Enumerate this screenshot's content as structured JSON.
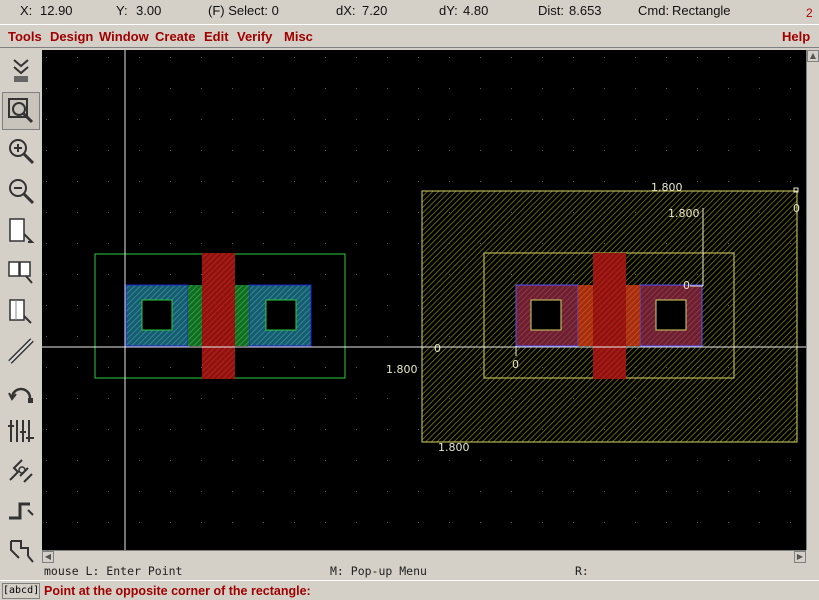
{
  "status": {
    "x_label": "X:",
    "x_value": "12.90",
    "y_label": "Y:",
    "y_value": "3.00",
    "select": "(F) Select: 0",
    "dx_label": "dX:",
    "dx_value": "7.20",
    "dy_label": "dY:",
    "dy_value": "4.80",
    "dist_label": "Dist:",
    "dist_value": "8.653",
    "cmd_label": "Cmd:",
    "cmd_value": "Rectangle",
    "window_number": "2"
  },
  "menu": {
    "items": [
      "Tools",
      "Design",
      "Window",
      "Create",
      "Edit",
      "Verify",
      "Misc"
    ],
    "help": "Help"
  },
  "toolbar": {
    "tools": [
      "save-icon",
      "zoom-fit-icon",
      "zoom-in-icon",
      "zoom-out-icon",
      "select-box-icon",
      "copy-icon",
      "stretch-icon",
      "ruler-icon",
      "undo-icon",
      "align-icon",
      "route-icon",
      "path-icon",
      "polygon-icon"
    ]
  },
  "canvas": {
    "dimension_labels": {
      "top_width": "1.800",
      "top_inner": "1.800",
      "left_mid": "1.800",
      "bottom": "1.800",
      "zero_top_right": "0",
      "zero_inner": "0",
      "zero_center": "0",
      "zero_bottom": "0"
    },
    "colors": {
      "background": "#000000",
      "grid_dot": "#5a5a5a",
      "crosshair": "#ffffff",
      "selection_box": "#d4d465",
      "hatch_fill": "#6a6a10",
      "cell_outline": "#2ecc40",
      "poly": "#c8201a",
      "diffusion": "#1a8c8c",
      "metal": "#2020d0",
      "contact": "#1a8a30"
    }
  },
  "mouse_line": {
    "left": "mouse L: Enter Point",
    "middle": "M: Pop-up Menu",
    "right": "R:"
  },
  "prompt_area": {
    "abcd": "[abcd]",
    "text": "Point at the opposite corner of the rectangle:"
  }
}
